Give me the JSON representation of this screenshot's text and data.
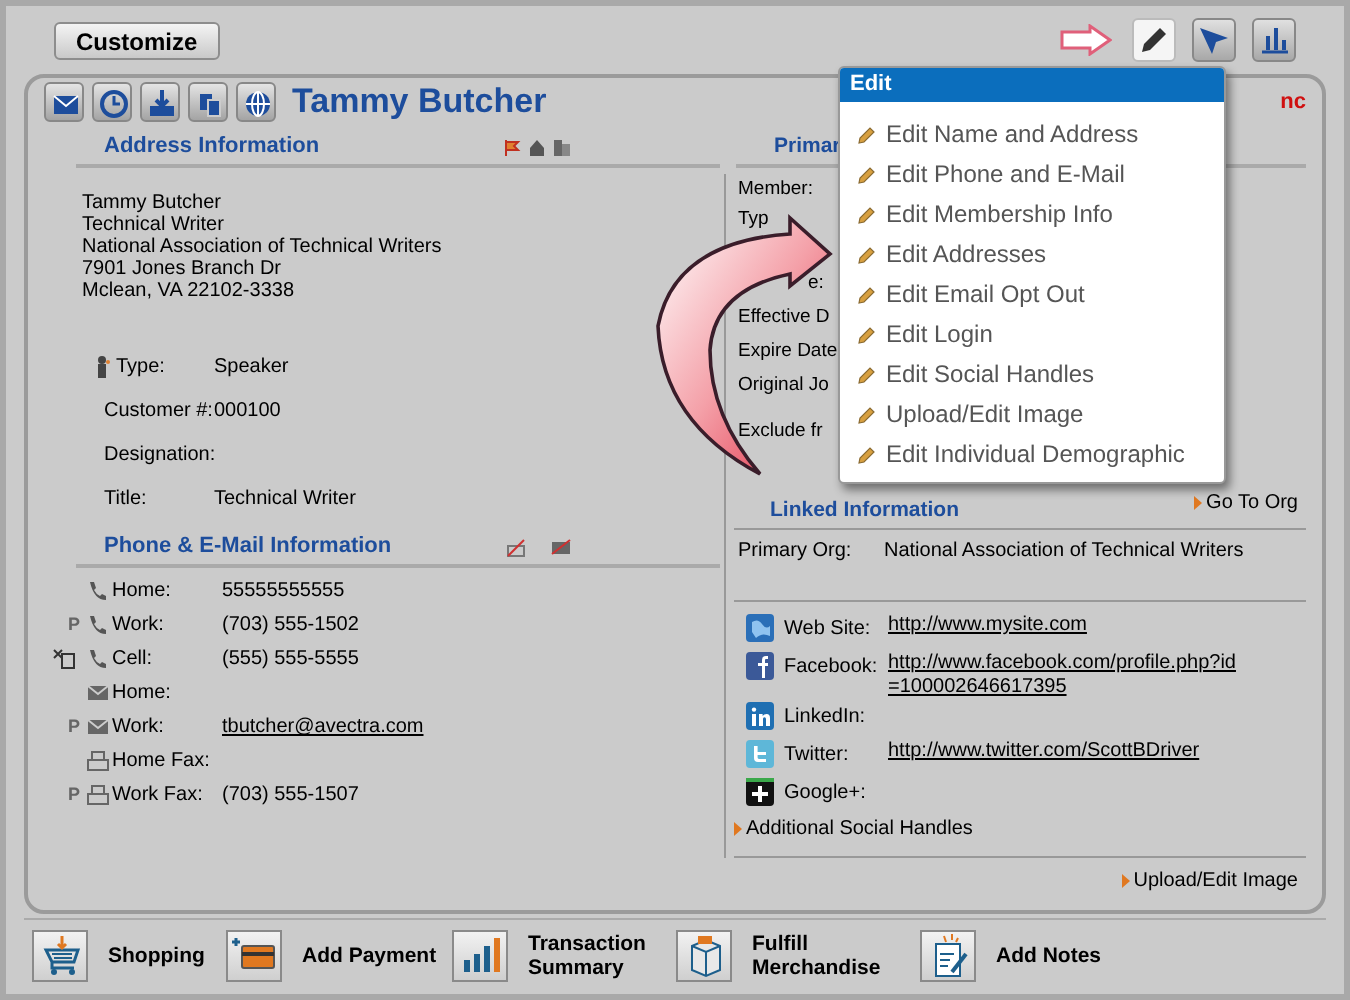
{
  "toolbar": {
    "customize": "Customize",
    "tools": [
      {
        "kind": "edit",
        "selected": true
      },
      {
        "kind": "pointer",
        "selected": false
      },
      {
        "kind": "chart",
        "selected": false
      }
    ]
  },
  "profile": {
    "name": "Tammy Butcher",
    "alert": "nc"
  },
  "address": {
    "heading": "Address Information",
    "lines": [
      "Tammy Butcher",
      "Technical Writer",
      "National Association of Technical Writers",
      "7901 Jones Branch Dr",
      "Mclean, VA 22102-3338"
    ],
    "fields": [
      {
        "label": "Type:",
        "value": "Speaker",
        "icon": true
      },
      {
        "label": "Customer #:",
        "value": "000100",
        "icon": false
      },
      {
        "label": "Designation:",
        "icon": false
      },
      {
        "label": "Title:",
        "value": "Technical Writer",
        "icon": false
      }
    ]
  },
  "phone_email": {
    "heading": "Phone & E-Mail Information",
    "rows": [
      {
        "kind": "phone",
        "label": "Home:",
        "value": "55555555555",
        "sms_opt_out": false
      },
      {
        "kind": "phone",
        "marker": "P",
        "label": "Work:",
        "value": "(703) 555-1502",
        "sms_opt_out": false
      },
      {
        "kind": "phone",
        "label": "Cell:",
        "value": "(555) 555-5555",
        "sms_opt_out": true
      },
      {
        "kind": "email",
        "label": "Home:",
        "sms_opt_out": false
      },
      {
        "kind": "email",
        "marker": "P",
        "label": "Work:",
        "value": "tbutcher@avectra.com",
        "link": true,
        "sms_opt_out": false
      },
      {
        "kind": "fax",
        "label": "Home Fax:",
        "sms_opt_out": false
      },
      {
        "kind": "fax",
        "marker": "P",
        "label": "Work Fax:",
        "value": "(703) 555-1507",
        "sms_opt_out": false
      }
    ]
  },
  "membership": {
    "heading": "Primar",
    "fields": [
      "Member:",
      "Typ",
      "e:",
      "Effective D",
      "Expire Date",
      "Original Jo",
      "Exclude fr"
    ]
  },
  "linked": {
    "heading": "Linked Information",
    "go_to": "Go To Org",
    "primary_org": {
      "label": "Primary Org:",
      "value": "National Association of Technical Writers"
    }
  },
  "social": {
    "rows": [
      {
        "kind": "web",
        "label": "Web Site:",
        "value": "http://www.mysite.com"
      },
      {
        "kind": "facebook",
        "label": "Facebook:",
        "value": "http://www.facebook.com/profile.php?id=100002646617395"
      },
      {
        "kind": "linkedin",
        "label": "LinkedIn:"
      },
      {
        "kind": "twitter",
        "label": "Twitter:",
        "value": "http://www.twitter.com/ScottBDriver"
      },
      {
        "kind": "google",
        "label": "Google+:"
      }
    ],
    "more": "Additional Social Handles",
    "upload": "Upload/Edit Image"
  },
  "edit_menu": {
    "title": "Edit",
    "items": [
      "Edit Name and Address",
      "Edit Phone and E-Mail",
      "Edit Membership Info",
      "Edit Addresses",
      "Edit Email Opt Out",
      "Edit Login",
      "Edit Social Handles",
      "Upload/Edit Image",
      "Edit Individual Demographic"
    ]
  },
  "actions": [
    {
      "kind": "cart",
      "label": "Shopping"
    },
    {
      "kind": "card",
      "label": "Add Payment"
    },
    {
      "kind": "bars",
      "label": "Transaction Summary"
    },
    {
      "kind": "box",
      "label": "Fulfill Merchandise"
    },
    {
      "kind": "notes",
      "label": "Add Notes"
    }
  ]
}
